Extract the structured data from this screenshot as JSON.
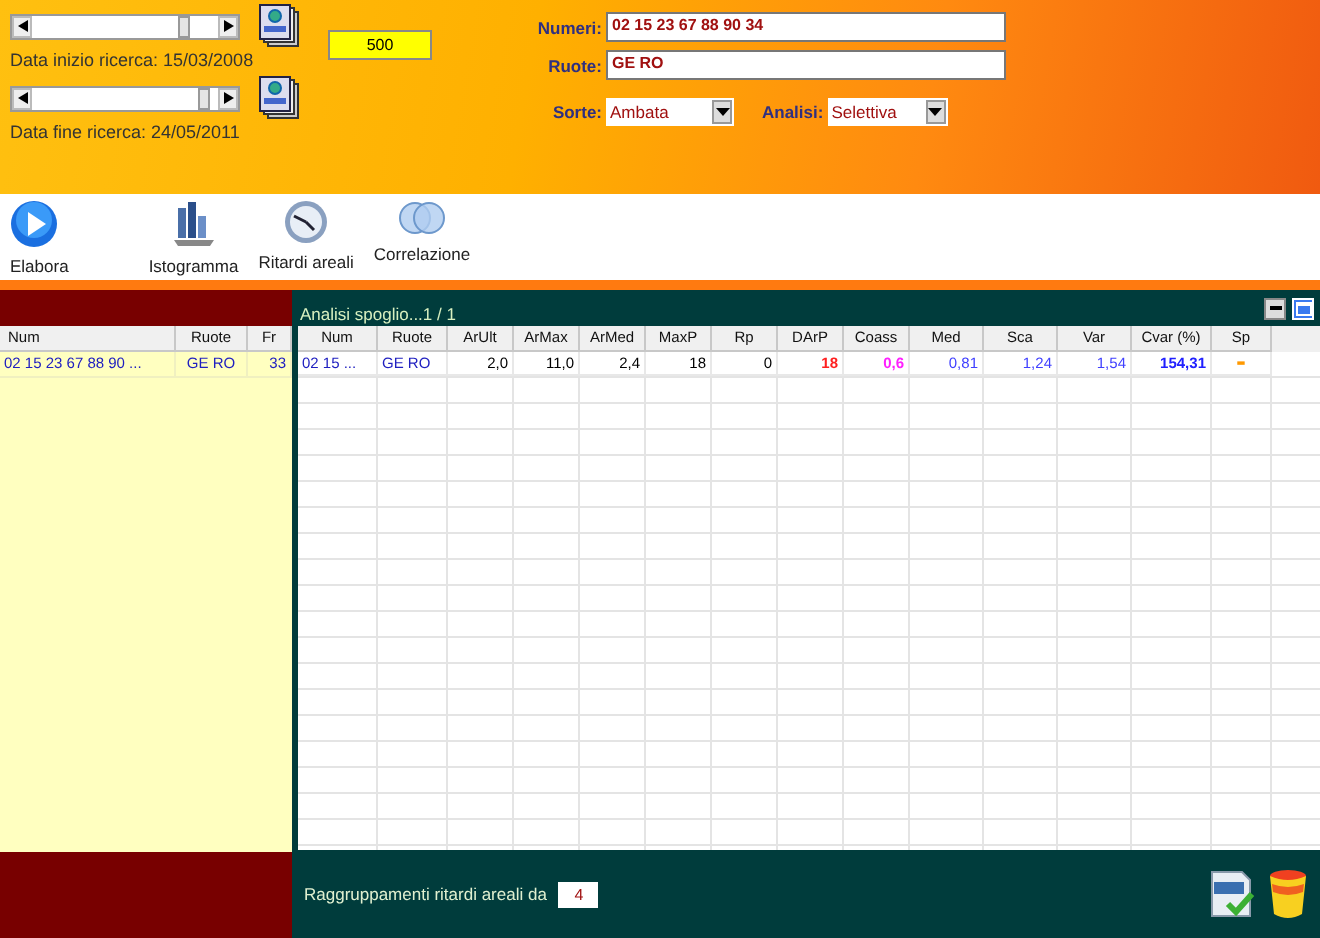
{
  "range": {
    "sliders": [
      {
        "level": 0.85,
        "label": "Data inizio ricerca:  15/03/2008"
      },
      {
        "level": 0.97,
        "label": "Data fine ricerca:  24/05/2011"
      }
    ],
    "count": "500"
  },
  "filters": {
    "numeri_label": "Numeri:",
    "numeri": "02 15 23 67 88 90 34",
    "ruote_label": "Ruote:",
    "ruote": "GE RO",
    "sorte_label": "Sorte:",
    "sorte": "Ambata",
    "analisi_label": "Analisi:",
    "analisi": "Selettiva"
  },
  "toolbar": [
    {
      "kind": "play",
      "label": "Elabora"
    },
    {
      "kind": "chart",
      "label": "Istogramma"
    },
    {
      "kind": "clock",
      "label": "Ritardi areali"
    },
    {
      "kind": "rings",
      "label": "Correlazione"
    }
  ],
  "left_table": {
    "columns": [
      "Num",
      "Ruote",
      "Fr"
    ],
    "rows": [
      [
        "02 15 23 67 88 90 ...",
        "GE RO",
        "33"
      ]
    ]
  },
  "analysis": {
    "title": "Analisi spoglio...1 / 1",
    "columns": [
      {
        "label": "Num",
        "color": "#2020c0"
      },
      {
        "label": "Ruote",
        "color": "#2020c0"
      },
      {
        "label": "ArUlt",
        "color": "#000000"
      },
      {
        "label": "ArMax",
        "color": "#000000"
      },
      {
        "label": "ArMed",
        "color": "#000000"
      },
      {
        "label": "MaxP",
        "color": "#000000"
      },
      {
        "label": "Rp",
        "color": "#000000"
      },
      {
        "label": "DArP",
        "color": "#ff2020"
      },
      {
        "label": "Coass",
        "color": "#ff20ff"
      },
      {
        "label": "Med",
        "color": "#4040ff"
      },
      {
        "label": "Sca",
        "color": "#4040ff"
      },
      {
        "label": "Var",
        "color": "#4040ff"
      },
      {
        "label": "Cvar (%)",
        "color": "#2020ff"
      },
      {
        "label": "Sp",
        "color": "#ff9900"
      }
    ],
    "rows": [
      [
        "02 15 ...",
        "GE RO",
        "2,0",
        "11,0",
        "2,4",
        "18",
        "0",
        "18",
        "0,6",
        "0,81",
        "1,24",
        "1,54",
        "154,31",
        "-"
      ]
    ],
    "grouping_label": "Raggruppamenti ritardi areali da",
    "grouping": "4"
  }
}
